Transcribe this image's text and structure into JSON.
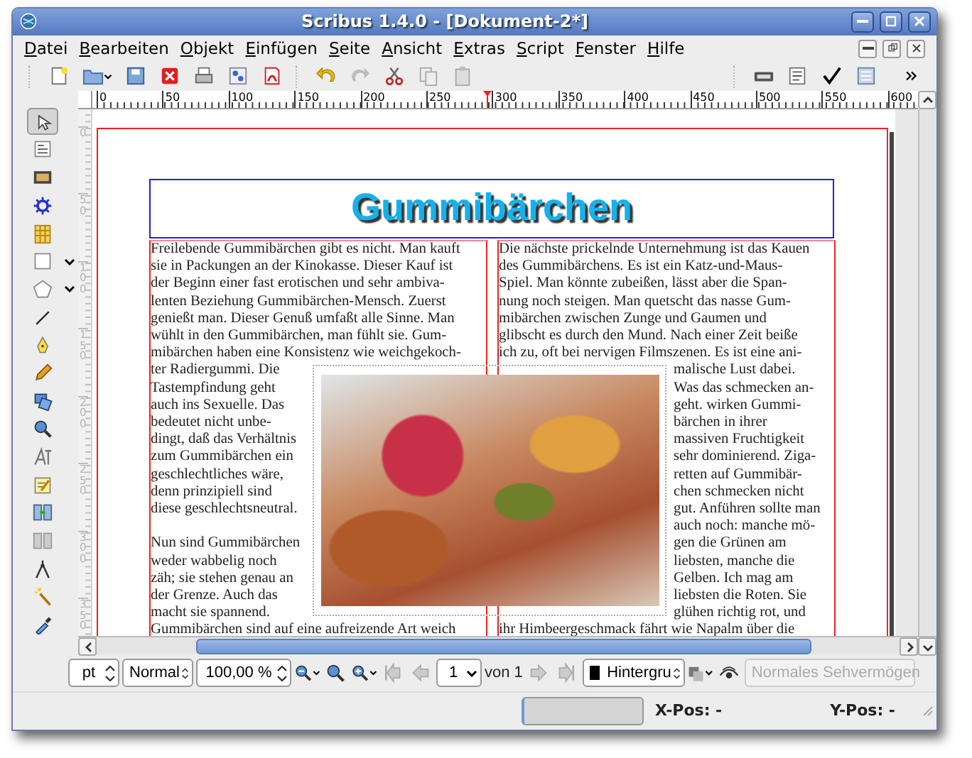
{
  "window": {
    "title": "Scribus 1.4.0 - [Dokument-2*]"
  },
  "menu": [
    "Datei",
    "Bearbeiten",
    "Objekt",
    "Einfügen",
    "Seite",
    "Ansicht",
    "Extras",
    "Script",
    "Fenster",
    "Hilfe"
  ],
  "toolbox": [
    {
      "selected": true,
      "menu": false
    },
    {
      "selected": false,
      "menu": false
    },
    {
      "selected": false,
      "menu": false
    },
    {
      "selected": false,
      "menu": false
    },
    {
      "selected": false,
      "menu": false
    },
    {
      "selected": false,
      "menu": true
    },
    {
      "selected": false,
      "menu": true
    },
    {
      "selected": false,
      "menu": false
    },
    {
      "selected": false,
      "menu": false
    },
    {
      "selected": false,
      "menu": false
    },
    {
      "selected": false,
      "menu": false
    },
    {
      "selected": false,
      "menu": false
    },
    {
      "selected": false,
      "menu": false
    },
    {
      "selected": false,
      "menu": false
    },
    {
      "selected": false,
      "menu": false
    },
    {
      "selected": false,
      "menu": false
    },
    {
      "selected": false,
      "menu": false
    },
    {
      "selected": false,
      "menu": false
    },
    {
      "selected": false,
      "menu": false
    }
  ],
  "rulers": {
    "horizontal": [
      "0",
      "50",
      "100",
      "150",
      "200",
      "250",
      "300",
      "350",
      "400",
      "450",
      "500",
      "550",
      "600"
    ],
    "vertical": [
      "0",
      "50",
      "100",
      "150",
      "200",
      "250",
      "300",
      "350"
    ]
  },
  "document": {
    "title": "Gummibärchen",
    "columns": [
      {
        "paragraphs": [
          {
            "lines": [
              "Freilebende Gummibärchen gibt es nicht. Man kauft",
              "sie in Packungen an der Kinokasse. Dieser Kauf ist",
              "der Beginn einer fast erotischen und sehr ambiva-",
              "lenten Beziehung Gummibärchen-Mensch. Zuerst",
              "genießt man. Dieser Genuß umfaßt alle Sinne. Man",
              "wühlt in den Gummibärchen, man fühlt sie. Gum-",
              "mibärchen haben eine Konsistenz wie weichgekoch-",
              "ter Radiergummi. Die",
              "Tastempfindung geht",
              "auch ins Sexuelle. Das",
              "bedeutet nicht unbe-",
              "dingt, daß das Verhältnis",
              "zum Gummibärchen ein",
              "geschlechtliches wäre,",
              "denn prinzipiell sind",
              "diese geschlechtsneutral."
            ]
          },
          {
            "lines": [
              "Nun sind Gummibärchen",
              "weder wabbelig noch",
              "zäh; sie stehen genau an",
              "der Grenze. Auch das",
              "macht sie spannend.",
              "Gummibärchen sind auf eine aufreizende Art weich"
            ]
          }
        ]
      },
      {
        "paragraphs": [
          {
            "lines": [
              "Die nächste prickelnde Unternehmung ist das Kauen",
              "des Gummibärchens. Es ist ein Katz-und-Maus-",
              "Spiel. Man könnte zubeißen, lässt aber die Span-",
              "nung noch steigen. Man quetscht das nasse Gum-",
              "mibärchen zwischen Zunge und Gaumen und",
              "glibscht es durch den Mund. Nach einer Zeit beiße",
              "ich zu, oft bei nervigen Filmszenen. Es ist eine ani-",
              "malische Lust dabei.",
              "Was das schmecken an-",
              "geht. wirken Gummi-",
              "bärchen in ihrer",
              "massiven Fruchtigkeit",
              "sehr dominierend. Ziga-",
              "retten auf Gummibär-",
              "chen schmecken nicht",
              "gut. Anführen sollte man",
              "auch noch: manche mö-",
              "gen die Grünen am",
              "liebsten, manche die",
              "Gelben. Ich mag am",
              "liebsten die Roten. Sie",
              "glühen richtig rot, und",
              "ihr Himbeergeschmack fährt wie Napalm über die"
            ]
          }
        ]
      }
    ]
  },
  "bottom_bar": {
    "unit": "pt",
    "mode": "Normal",
    "zoom": "100,00 %",
    "page": "1",
    "page_count": "von 1",
    "layer": "Hintergru",
    "vision": {
      "value": "Normales Sehvermögen",
      "disabled": true
    }
  },
  "status_bar": {
    "progress": {
      "level": 0
    },
    "x_pos": "X-Pos: -",
    "y_pos": "Y-Pos: -"
  }
}
